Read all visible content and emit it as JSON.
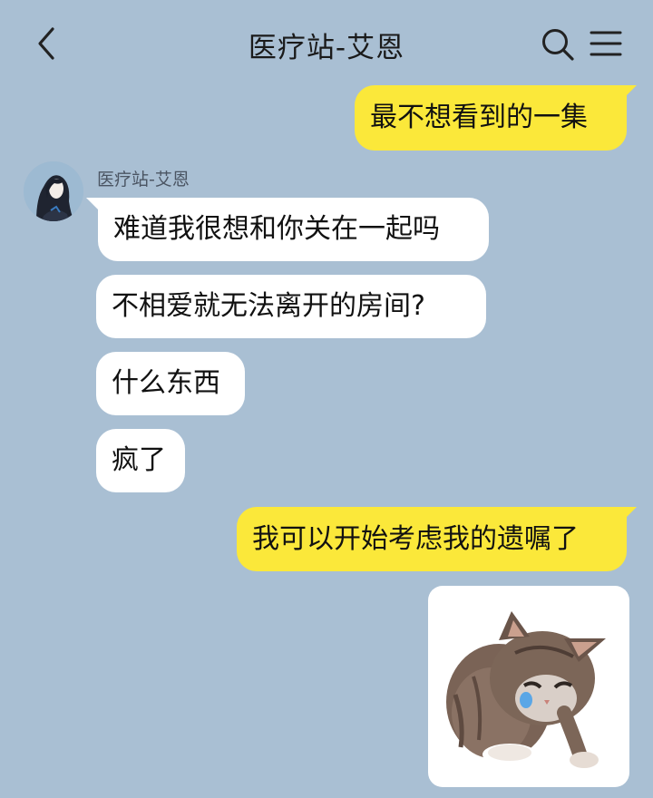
{
  "header": {
    "title": "医疗站-艾恩",
    "back_icon": "chevron-left-icon",
    "search_icon": "search-icon",
    "menu_icon": "hamburger-menu-icon"
  },
  "contact": {
    "name": "医疗站-艾恩",
    "avatar_icon": "contact-avatar"
  },
  "messages": [
    {
      "from": "me",
      "text": "最不想看到的一集"
    },
    {
      "from": "them",
      "text": "难道我很想和你关在一起吗"
    },
    {
      "from": "them",
      "text": "不相爱就无法离开的房间?"
    },
    {
      "from": "them",
      "text": "什么东西"
    },
    {
      "from": "them",
      "text": "疯了"
    },
    {
      "from": "me",
      "text": "我可以开始考虑我的遗嘱了"
    },
    {
      "from": "me",
      "sticker": "kitten-sticker"
    }
  ],
  "colors": {
    "background": "#a9bfd3",
    "my_bubble": "#fbe83a",
    "their_bubble": "#ffffff"
  }
}
